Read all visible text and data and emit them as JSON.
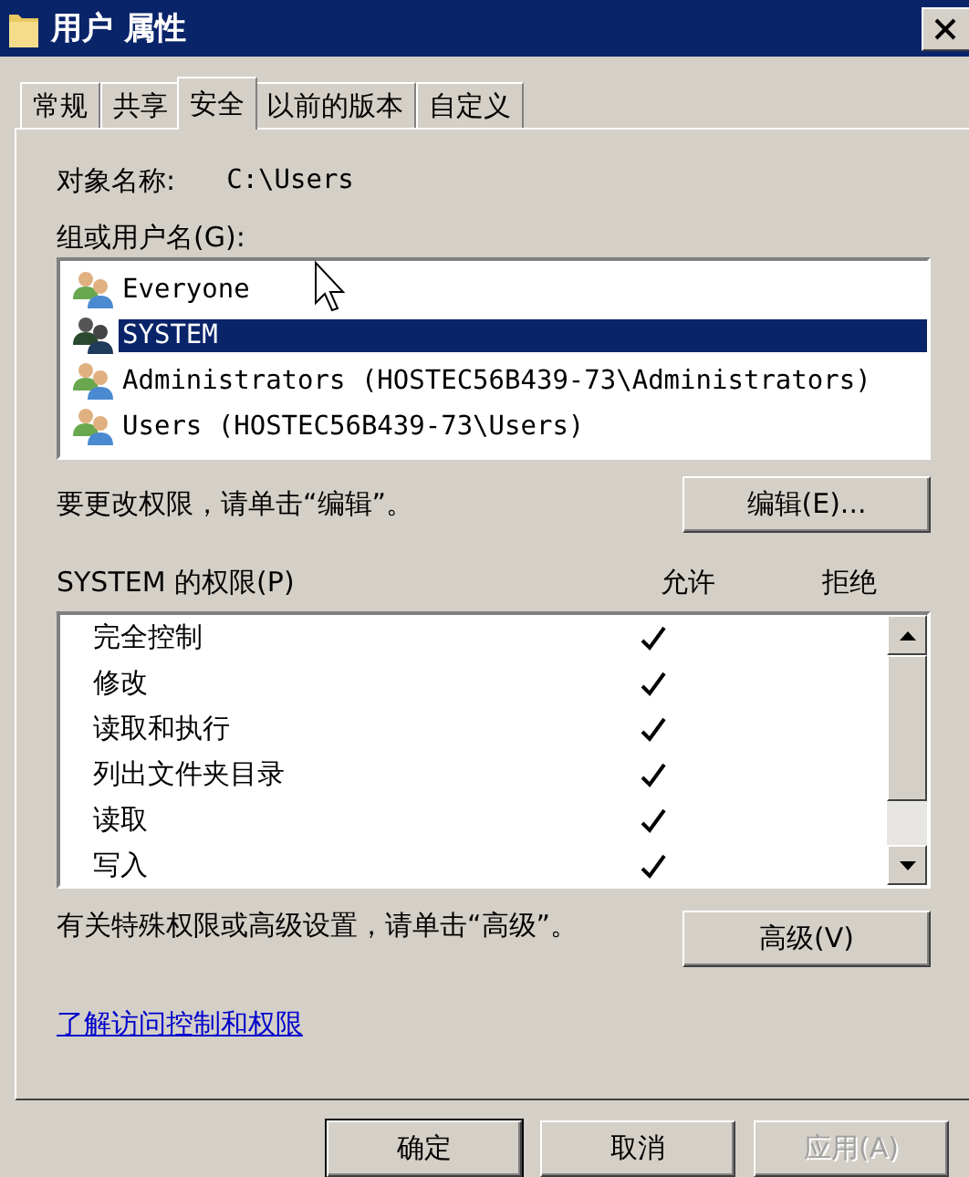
{
  "window": {
    "title": "用户 属性"
  },
  "tabs": [
    {
      "label": "常规",
      "selected": false
    },
    {
      "label": "共享",
      "selected": false
    },
    {
      "label": "安全",
      "selected": true
    },
    {
      "label": "以前的版本",
      "selected": false
    },
    {
      "label": "自定义",
      "selected": false
    }
  ],
  "object_name": {
    "label": "对象名称:",
    "value": "C:\\Users"
  },
  "groups": {
    "label": "组或用户名(G):",
    "items": [
      {
        "name": "Everyone",
        "selected": false
      },
      {
        "name": "SYSTEM",
        "selected": true
      },
      {
        "name": "Administrators (HOSTEC56B439-73\\Administrators)",
        "selected": false
      },
      {
        "name": "Users (HOSTEC56B439-73\\Users)",
        "selected": false
      }
    ]
  },
  "change_hint": "要更改权限，请单击“编辑”。",
  "edit_button": "编辑(E)...",
  "permissions": {
    "label": "SYSTEM 的权限(P)",
    "columns": [
      "允许",
      "拒绝"
    ],
    "rows": [
      {
        "name": "完全控制",
        "allow": true,
        "deny": false
      },
      {
        "name": "修改",
        "allow": true,
        "deny": false
      },
      {
        "name": "读取和执行",
        "allow": true,
        "deny": false
      },
      {
        "name": "列出文件夹目录",
        "allow": true,
        "deny": false
      },
      {
        "name": "读取",
        "allow": true,
        "deny": false
      },
      {
        "name": "写入",
        "allow": true,
        "deny": false
      }
    ]
  },
  "advanced_hint": "有关特殊权限或高级设置，请单击“高级”。",
  "advanced_button": "高级(V)",
  "help_link": "了解访问控制和权限",
  "buttons": [
    {
      "label": "确定",
      "disabled": false,
      "default": true
    },
    {
      "label": "取消",
      "disabled": false,
      "default": false
    },
    {
      "label": "应用(A)",
      "disabled": true,
      "default": false
    }
  ]
}
